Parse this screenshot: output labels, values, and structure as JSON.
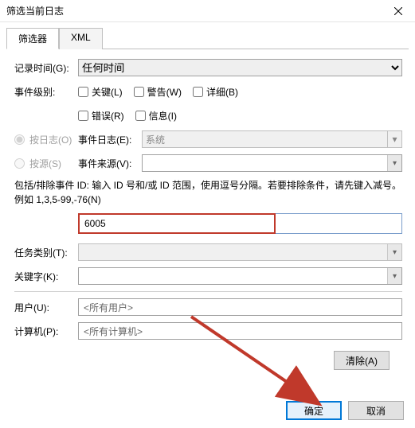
{
  "window": {
    "title": "筛选当前日志"
  },
  "tabs": {
    "filter": "筛选器",
    "xml": "XML"
  },
  "labels": {
    "logtime": "记录时间(G):",
    "level": "事件级别:",
    "bylog": "按日志(O)",
    "bysource": "按源(S)",
    "eventlog": "事件日志(E):",
    "eventsrc": "事件来源(V):",
    "taskcat": "任务类别(T):",
    "keyword": "关键字(K):",
    "user": "用户(U):",
    "computer": "计算机(P):"
  },
  "values": {
    "logtime": "任何时间",
    "eventlog": "系统",
    "event_id": "6005",
    "user": "<所有用户>",
    "computer": "<所有计算机>"
  },
  "checkboxes": {
    "critical": "关键(L)",
    "warning": "警告(W)",
    "verbose": "详细(B)",
    "error": "错误(R)",
    "info": "信息(I)"
  },
  "help": "包括/排除事件 ID: 输入 ID 号和/或 ID 范围，使用逗号分隔。若要排除条件，请先键入减号。例如 1,3,5-99,-76(N)",
  "buttons": {
    "clear": "清除(A)",
    "ok": "确定",
    "cancel": "取消"
  },
  "icons": {
    "dropdown": "▾"
  }
}
